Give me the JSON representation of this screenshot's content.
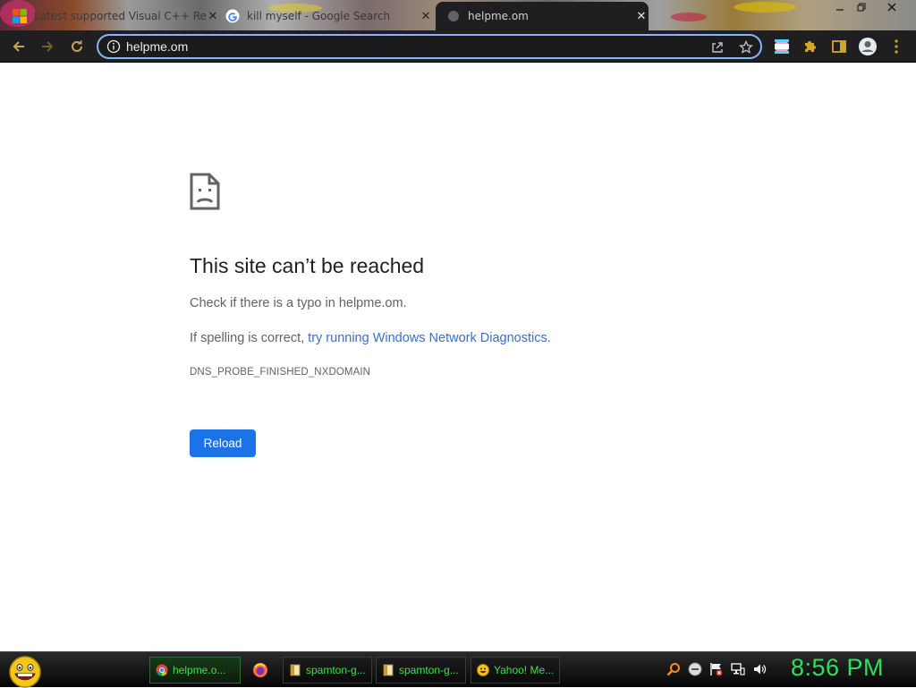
{
  "browser": {
    "tabs": [
      {
        "title": "Latest supported Visual C++ Re",
        "favicon": "microsoft-logo"
      },
      {
        "title": "kill myself - Google Search",
        "favicon": "google-logo"
      },
      {
        "title": "helpme.om",
        "favicon": "default-page-icon",
        "active": true
      }
    ],
    "close_glyph": "✕",
    "address": {
      "value": "helpme.om"
    }
  },
  "error_page": {
    "title": "This site can’t be reached",
    "line1": "Check if there is a typo in helpme.om.",
    "line2_prefix": "If spelling is correct, ",
    "line2_link": "try running Windows Network Diagnostics",
    "line2_suffix": ".",
    "error_code": "DNS_PROBE_FINISHED_NXDOMAIN",
    "reload_label": "Reload"
  },
  "taskbar": {
    "items": [
      {
        "label": "helpme.o...",
        "icon": "chrome-icon",
        "active": true
      },
      {
        "label": "",
        "icon": "firefox-icon"
      },
      {
        "label": "spamton-g...",
        "icon": "folder-icon"
      },
      {
        "label": "spamton-g...",
        "icon": "folder-icon"
      },
      {
        "label": "Yahoo! Me...",
        "icon": "yahoo-messenger-icon"
      }
    ],
    "clock": "8:56 PM"
  },
  "colors": {
    "accent": "#1a73e8",
    "link": "#3a6fc4",
    "taskbar_text": "#3fe04a",
    "clock": "#2ee05a",
    "toolbar": "#1f1f21"
  }
}
